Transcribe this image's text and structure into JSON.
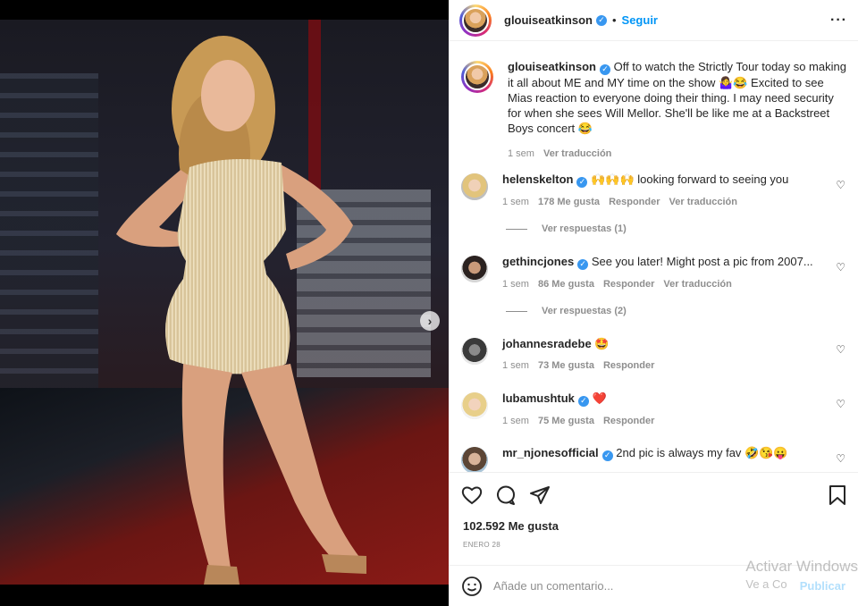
{
  "post": {
    "author": "glouiseatkinson",
    "follow_label": "Seguir",
    "separator": "•",
    "caption": "Off to watch the Strictly Tour today so making it all about ME and MY time on the show 🤷‍♀️😂 Excited to see Mias reaction to everyone doing their thing. I may need security for when she sees Will Mellor. She'll be like me at a Backstreet Boys concert 😂",
    "caption_time": "1 sem",
    "caption_translate": "Ver traducción",
    "likes": "102.592 Me gusta",
    "date": "ENERO 28",
    "carousel": {
      "dots": 5,
      "active": 0
    }
  },
  "comments": [
    {
      "user": "helenskelton",
      "verified": true,
      "text": "🙌🙌🙌 looking forward to seeing you",
      "time": "1 sem",
      "likes": "178 Me gusta",
      "reply": "Responder",
      "translate": "Ver traducción",
      "replies": "Ver respuestas (1)"
    },
    {
      "user": "gethincjones",
      "verified": true,
      "text": "See you later! Might post a pic from 2007...",
      "time": "1 sem",
      "likes": "86 Me gusta",
      "reply": "Responder",
      "translate": "Ver traducción",
      "replies": "Ver respuestas (2)"
    },
    {
      "user": "johannesradebe",
      "verified": false,
      "text": "🤩",
      "time": "1 sem",
      "likes": "73 Me gusta",
      "reply": "Responder"
    },
    {
      "user": "lubamushtuk",
      "verified": true,
      "text": "❤️",
      "time": "1 sem",
      "likes": "75 Me gusta",
      "reply": "Responder"
    },
    {
      "user": "mr_njonesofficial",
      "verified": true,
      "text": "2nd pic is always my fav 🤣😘😛"
    }
  ],
  "add_comment": {
    "placeholder": "Añade un comentario...",
    "publish": "Publicar"
  },
  "watermark": "Activar Windows",
  "watermark_sub": "Ve a Co",
  "colors": {
    "accent": "#0095f6",
    "verified": "#3897f0",
    "muted": "#8e8e8e"
  },
  "icons": [
    "more-icon",
    "heart-icon",
    "comment-icon",
    "share-icon",
    "save-icon",
    "emoji-icon",
    "chevron-right-icon",
    "verified-icon"
  ]
}
